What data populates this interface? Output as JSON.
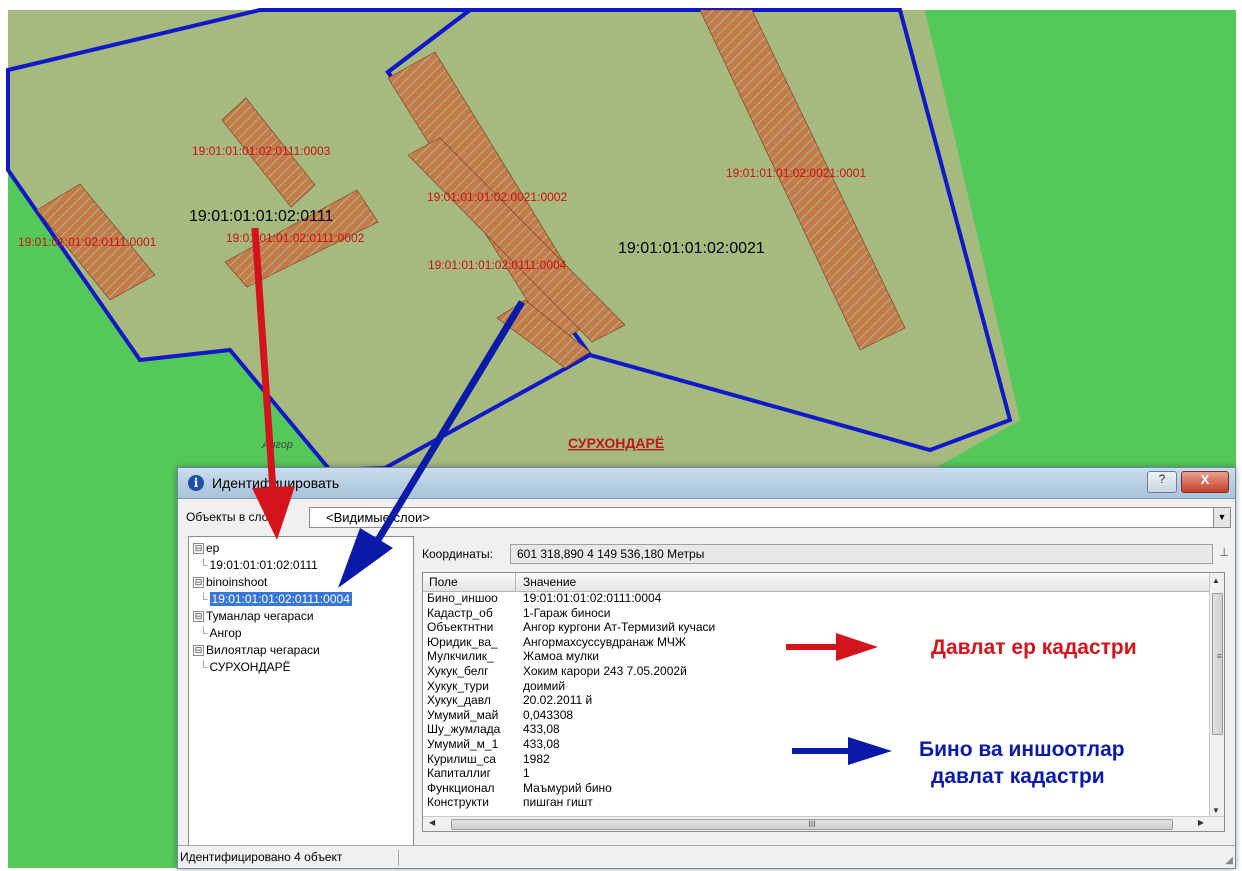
{
  "map": {
    "parcel_labels": [
      "19:01:01:01:02:0111:0003",
      "19:01:01:01:02:0021:0002",
      "19:01:01:01:02:0021:0001",
      "19:01:01:01:02:0111:0001",
      "19:01:01:01:02:0111:0002",
      "19:01:01:01:02:0111:0004"
    ],
    "zone_labels": [
      "19:01:01:01:02:0111",
      "19:01:01:01:02:0021"
    ],
    "district_label": "Ангор",
    "region_label": "СУРХОНДАРЁ",
    "colors": {
      "grass": "#55c85a",
      "parcel": "#a6b97f",
      "boundary": "#1018c8",
      "building": "#c6794a",
      "label_red": "#d01010"
    }
  },
  "window": {
    "title": "Идентифицировать",
    "help_button": "?",
    "close_button": "X",
    "layers_label": "Объекты в слое:",
    "layers_value": "<Видимые слои>",
    "coords_label": "Координаты:",
    "coords_value": "601 318,890  4 149 536,180 Метры",
    "tree": [
      {
        "text": "ер",
        "toggle": "⊟"
      },
      {
        "text": "19:01:01:01:02:0111"
      },
      {
        "text": "binoinshoot",
        "toggle": "⊟"
      },
      {
        "text": "19:01:01:01:02:0111:0004"
      },
      {
        "text": "Туманлар чегараси",
        "toggle": "⊟"
      },
      {
        "text": "Ангор"
      },
      {
        "text": "Вилоятлар чегараси",
        "toggle": "⊟"
      },
      {
        "text": "СУРХОНДАРЁ"
      }
    ],
    "grid": {
      "headers": [
        "Поле",
        "Значение"
      ],
      "rows": [
        [
          "Бино_иншоо",
          "19:01:01:01:02:0111:0004"
        ],
        [
          "Кадастр_об",
          "1-Гараж биноси"
        ],
        [
          "Объектнтни",
          "Ангор кургони Ат-Термизий кучаси"
        ],
        [
          "Юридик_ва_",
          "Ангормахсуссувдранаж МЧЖ"
        ],
        [
          "Мулкчилик_",
          "Жамоа мулки"
        ],
        [
          "Хукук_белг",
          "Хоким карори 243 7.05.2002й"
        ],
        [
          "Хукук_тури",
          "доимий"
        ],
        [
          "Хукук_давл",
          "20.02.2011 й"
        ],
        [
          "Умумий_май",
          "0,043308"
        ],
        [
          "Шу_жумлада",
          "433,08"
        ],
        [
          "Умумий_м_1",
          "433,08"
        ],
        [
          "Курилиш_са",
          "1982"
        ],
        [
          "Капиталлиг",
          "1"
        ],
        [
          "Функционал",
          "Маъмурий бино"
        ],
        [
          "Конструкти",
          "пишган гишт"
        ]
      ]
    },
    "status": "Идентифицировано 4 объект"
  },
  "legend": {
    "red_text": "Давлат ер кадастри",
    "blue_line1": "Бино ва иншоотлар",
    "blue_line2": "давлат кадастри",
    "red_color": "#d4141c",
    "blue_color": "#0a1aa8"
  }
}
